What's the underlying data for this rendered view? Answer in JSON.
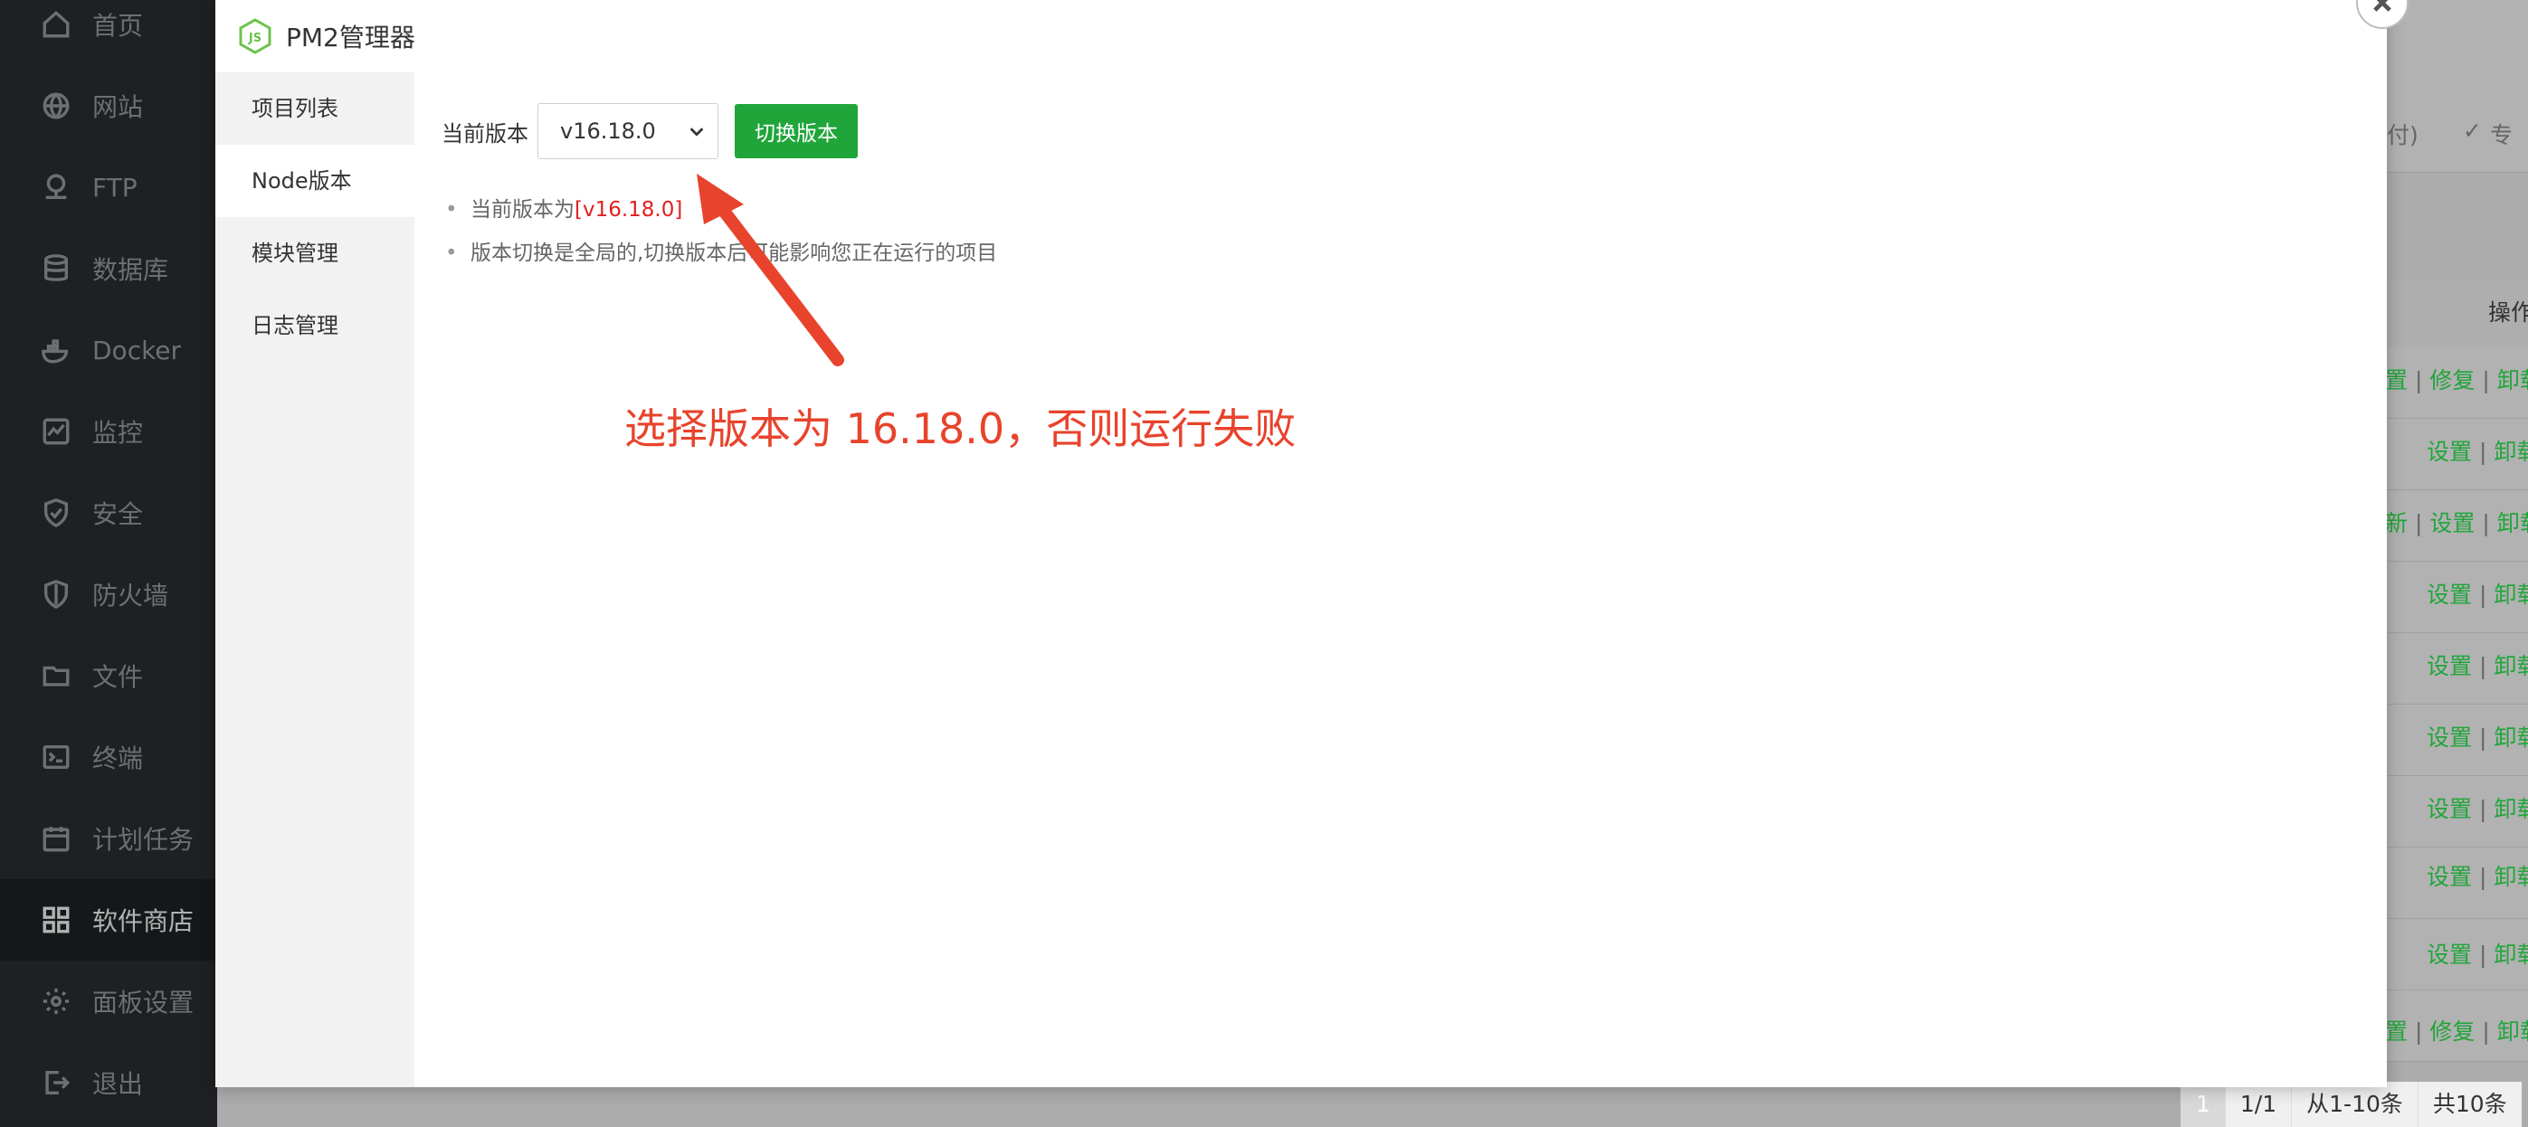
{
  "sidebar": {
    "items": [
      {
        "label": "首页",
        "icon": "home-icon"
      },
      {
        "label": "网站",
        "icon": "globe-icon"
      },
      {
        "label": "FTP",
        "icon": "ftp-icon"
      },
      {
        "label": "数据库",
        "icon": "database-icon"
      },
      {
        "label": "Docker",
        "icon": "docker-icon"
      },
      {
        "label": "监控",
        "icon": "monitor-icon"
      },
      {
        "label": "安全",
        "icon": "shield-icon"
      },
      {
        "label": "防火墙",
        "icon": "firewall-icon"
      },
      {
        "label": "文件",
        "icon": "folder-icon"
      },
      {
        "label": "终端",
        "icon": "terminal-icon"
      },
      {
        "label": "计划任务",
        "icon": "calendar-icon"
      },
      {
        "label": "软件商店",
        "icon": "grid-icon",
        "active": true
      },
      {
        "label": "面板设置",
        "icon": "gear-icon"
      },
      {
        "label": "退出",
        "icon": "logout-icon"
      }
    ]
  },
  "dialog": {
    "title": "PM2管理器",
    "logo_text": "JS",
    "tabs": [
      "项目列表",
      "Node版本",
      "模块管理",
      "日志管理"
    ],
    "active_tab": "Node版本",
    "version_label": "当前版本",
    "selected_version": "v16.18.0",
    "switch_button": "切换版本",
    "tip1_prefix": "当前版本为",
    "tip1_version": "[v16.18.0]",
    "tip2": "版本切换是全局的,切换版本后可能影响您正在运行的项目"
  },
  "annotation": {
    "text": "选择版本为 16.18.0，否则运行失败",
    "color": "#e8432c"
  },
  "background": {
    "header_right_1": "付)",
    "header_right_2": "专",
    "table_header": "操作",
    "row_actions": [
      {
        "text_green_a": "置",
        "text_green_b": "修复",
        "text_green_c": "卸载"
      },
      {
        "text_green_a": "设置",
        "text_green_c": "卸载"
      },
      {
        "text_green_a": "新",
        "text_green_b": "设置",
        "text_green_c": "卸载"
      },
      {
        "text_green_a": "设置",
        "text_green_c": "卸载"
      },
      {
        "text_green_a": "设置",
        "text_green_c": "卸载"
      },
      {
        "text_green_a": "设置",
        "text_green_c": "卸载"
      },
      {
        "text_green_a": "设置",
        "text_green_c": "卸载"
      },
      {
        "text_green_a": "设置",
        "text_green_c": "卸载"
      },
      {
        "text_green_a": "设置",
        "text_green_c": "卸载"
      },
      {
        "text_green_a": "置",
        "text_green_b": "修复",
        "text_green_c": "卸载"
      }
    ],
    "pagination": {
      "current": "1",
      "pages": "1/1",
      "range": "从1-10条",
      "total": "共10条"
    }
  },
  "colors": {
    "accent": "#20a53a",
    "sidebar_bg": "#2b2f33",
    "red": "#e02020"
  }
}
